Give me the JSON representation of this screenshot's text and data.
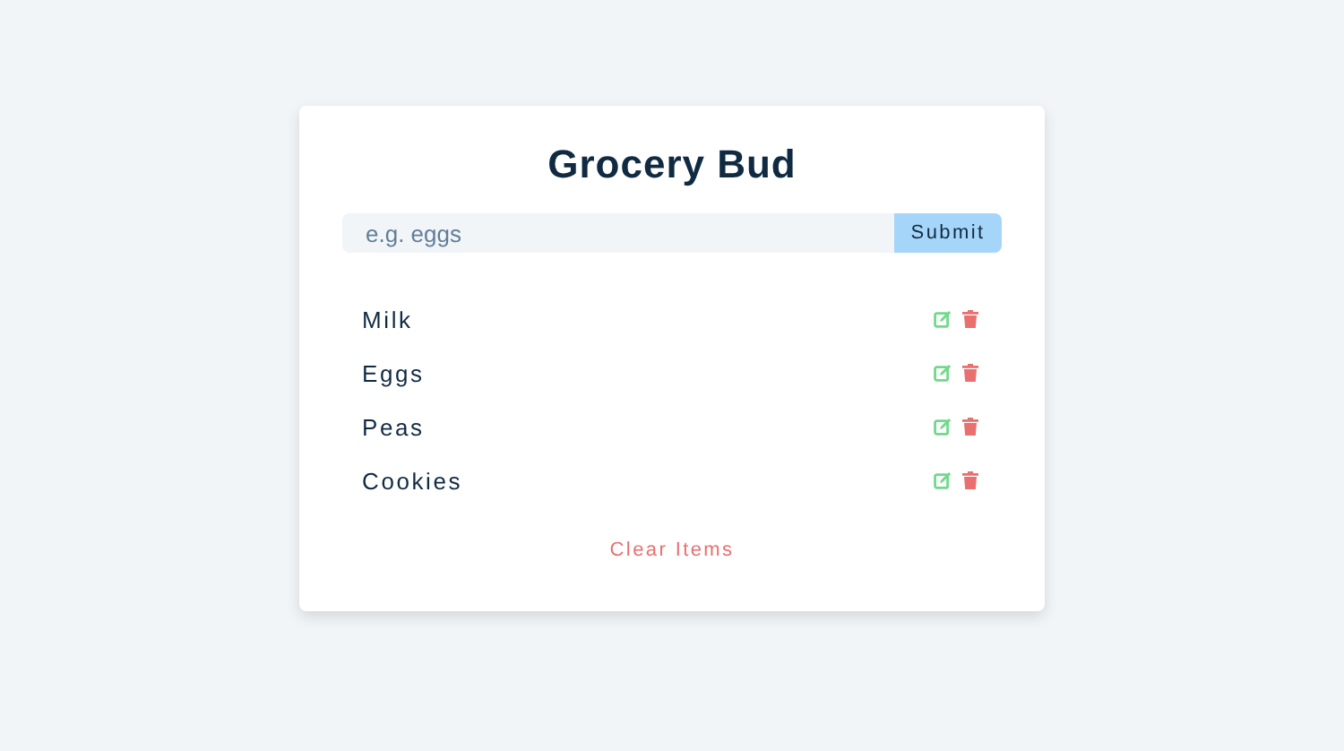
{
  "title": "Grocery Bud",
  "form": {
    "placeholder": "e.g. eggs",
    "button": "Submit"
  },
  "items": [
    {
      "name": "Milk"
    },
    {
      "name": "Eggs"
    },
    {
      "name": "Peas"
    },
    {
      "name": "Cookies"
    }
  ],
  "clear": "Clear Items"
}
